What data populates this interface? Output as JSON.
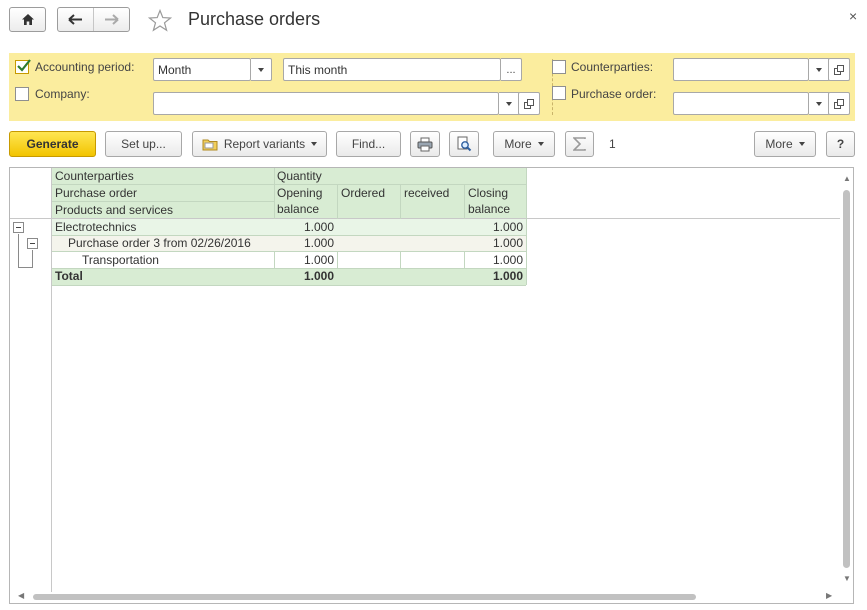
{
  "window": {
    "title": "Purchase orders",
    "close_glyph": "×"
  },
  "icons": {
    "home": "home-icon",
    "back": "arrow-left-icon",
    "forward": "arrow-right-icon",
    "favorite": "star-icon",
    "print": "printer-icon",
    "preview": "print-preview-icon",
    "sum": "sigma-icon",
    "report_variants": "folder-icon"
  },
  "filters": {
    "accounting_period": {
      "label": "Accounting period:",
      "checked": true,
      "period_type": "Month",
      "period_value": "This month",
      "dots": "..."
    },
    "company": {
      "label": "Company:",
      "checked": false,
      "value": ""
    },
    "counterparties": {
      "label": "Counterparties:",
      "checked": false,
      "value": ""
    },
    "purchase_order": {
      "label": "Purchase order:",
      "checked": false,
      "value": ""
    }
  },
  "toolbar": {
    "generate": "Generate",
    "setup": "Set up...",
    "report_variants": "Report variants",
    "find": "Find...",
    "more1": "More",
    "sum_value": "1",
    "more2": "More",
    "help": "?"
  },
  "report": {
    "headers": {
      "group1": "Counterparties",
      "group2": "Purchase order",
      "group3": "Products and services",
      "quantity": "Quantity",
      "opening_1": "Opening",
      "opening_2": "balance",
      "ordered": "Ordered",
      "received": "received",
      "closing_1": "Closing",
      "closing_2": "balance"
    },
    "rows": [
      {
        "name": "Electrotechnics",
        "opening": "1.000",
        "ordered": "",
        "received": "",
        "closing": "1.000"
      },
      {
        "name": "Purchase order 3 from 02/26/2016",
        "opening": "1.000",
        "ordered": "",
        "received": "",
        "closing": "1.000"
      },
      {
        "name": "Transportation",
        "opening": "1.000",
        "ordered": "",
        "received": "",
        "closing": "1.000"
      }
    ],
    "total": {
      "name": "Total",
      "opening": "1.000",
      "ordered": "",
      "received": "",
      "closing": "1.000"
    }
  },
  "colors": {
    "filter_bg": "#fbed9e",
    "generate_bg": "#f7d100",
    "header_bg": "#d8ecd3",
    "row1_bg": "#e9f5e7",
    "row2_bg": "#f4f4ec",
    "total_bg": "#d8ecd3"
  }
}
